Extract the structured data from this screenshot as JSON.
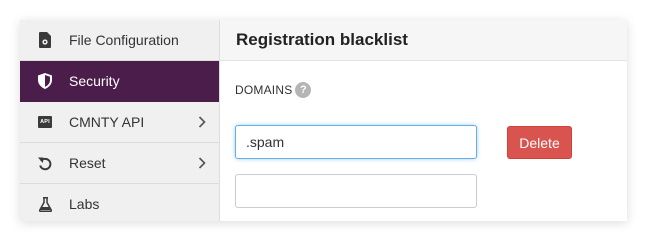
{
  "sidebar": {
    "items": [
      {
        "label": "File Configuration",
        "icon": "file-gear-icon",
        "active": false,
        "has_chevron": false
      },
      {
        "label": "Security",
        "icon": "shield-icon",
        "active": true,
        "has_chevron": false
      },
      {
        "label": "CMNTY API",
        "icon": "api-icon",
        "icon_text": "API",
        "active": false,
        "has_chevron": true
      },
      {
        "label": "Reset",
        "icon": "reset-icon",
        "active": false,
        "has_chevron": true
      },
      {
        "label": "Labs",
        "icon": "flask-icon",
        "active": false,
        "has_chevron": false
      }
    ]
  },
  "main": {
    "title": "Registration blacklist",
    "section_label": "DOMAINS",
    "help_icon_text": "?",
    "domains": [
      {
        "value": ".spam",
        "placeholder": "",
        "focused": true
      },
      {
        "value": "",
        "placeholder": "",
        "focused": false
      }
    ],
    "delete_label": "Delete"
  },
  "colors": {
    "active_bg": "#4b1d4a",
    "delete_bg": "#d9534f",
    "focus_border": "#66afe9"
  }
}
